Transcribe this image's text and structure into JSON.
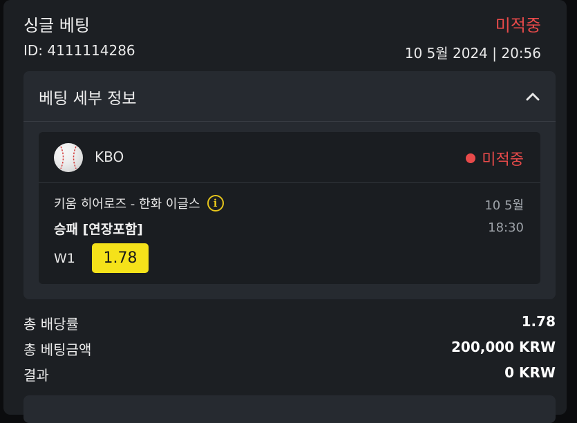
{
  "header": {
    "title": "싱글 베팅",
    "status": "미적중",
    "bet_id": "ID: 4111114286",
    "datetime": "10 5월 2024 | 20:56"
  },
  "details": {
    "title": "베팅 세부 정보",
    "toggle_icon": "chevron-up-icon"
  },
  "event": {
    "sport_icon": "baseball-icon",
    "league": "KBO",
    "status": "미적중",
    "match": "키움 히어로즈 - 한화 이글스",
    "info_icon": "info-icon",
    "market": "승패 [연장포함]",
    "date": "10 5월",
    "time": "18:30",
    "selection": "W1",
    "odds": "1.78"
  },
  "summary": [
    {
      "label": "총 배당률",
      "value": "1.78"
    },
    {
      "label": "총 베팅금액",
      "value": "200,000 KRW"
    },
    {
      "label": "결과",
      "value": "0 KRW"
    }
  ],
  "colors": {
    "lost_red": "#e84a4a",
    "odds_yellow": "#f5e21a",
    "card_bg": "#1c1f23",
    "panel_bg": "#262a30"
  }
}
